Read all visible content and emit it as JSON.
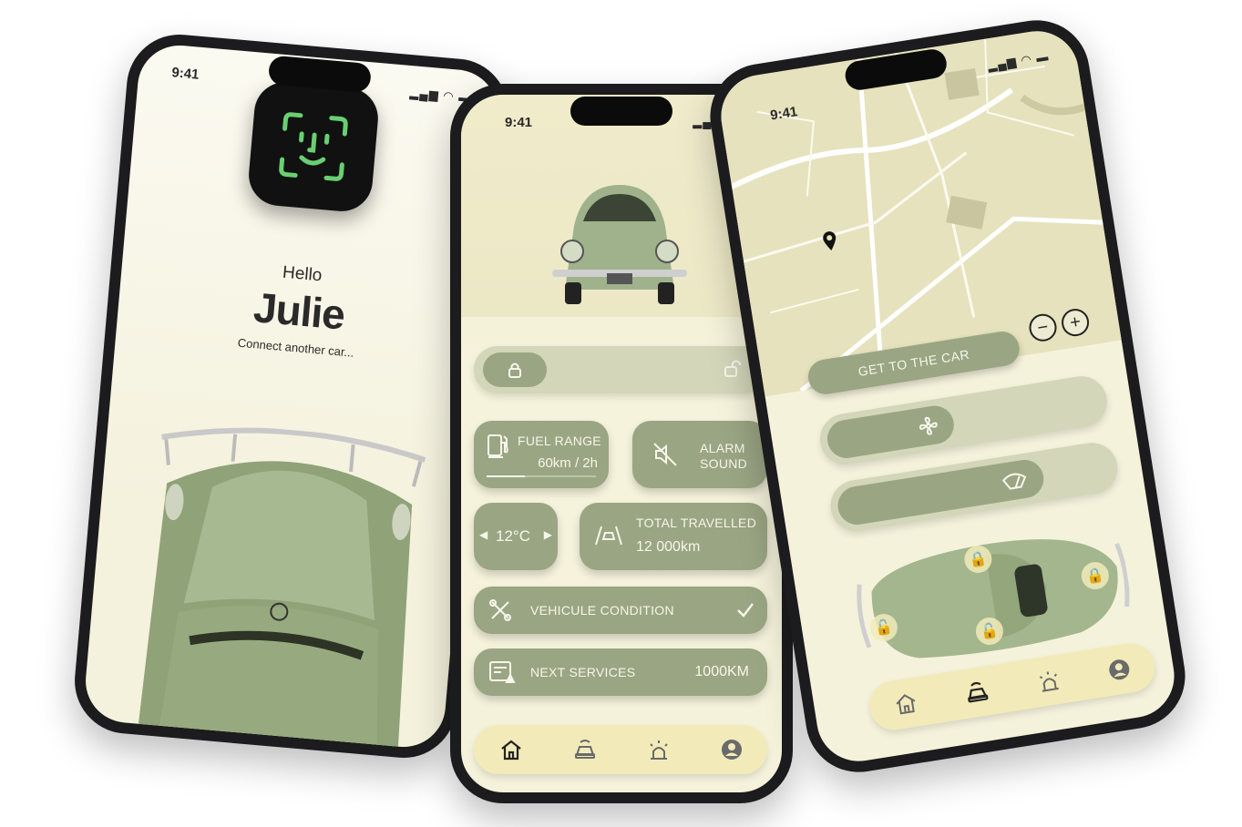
{
  "status_bar": {
    "time": "9:41",
    "signal": "▂▄▆",
    "wifi": "wifi-icon",
    "battery": "▭"
  },
  "welcome_screen": {
    "greeting": "Hello",
    "user_name": "Julie",
    "connect_link": "Connect another car..."
  },
  "dashboard": {
    "fuel": {
      "label": "FUEL RANGE",
      "value": "60km / 2h",
      "fraction": 0.35
    },
    "alarm": {
      "line1": "ALARM",
      "line2": "SOUND"
    },
    "temperature": {
      "value": "12°C"
    },
    "travel": {
      "label": "TOTAL TRAVELLED",
      "value": "12 000km"
    },
    "condition": {
      "label": "VEHICULE CONDITION"
    },
    "services": {
      "label": "NEXT SERVICES",
      "value": "1000KM"
    }
  },
  "map_screen": {
    "get_to_car": "GET TO THE CAR",
    "zoom_out": "−",
    "zoom_in": "+"
  },
  "nav": {
    "items": [
      "home-icon",
      "car-remote-icon",
      "alarm-icon",
      "profile-icon"
    ]
  },
  "colors": {
    "accent": "#9aa583",
    "cream": "#f2ebb9",
    "pale": "#d3d6b9",
    "bg": "#f5f2dc"
  }
}
